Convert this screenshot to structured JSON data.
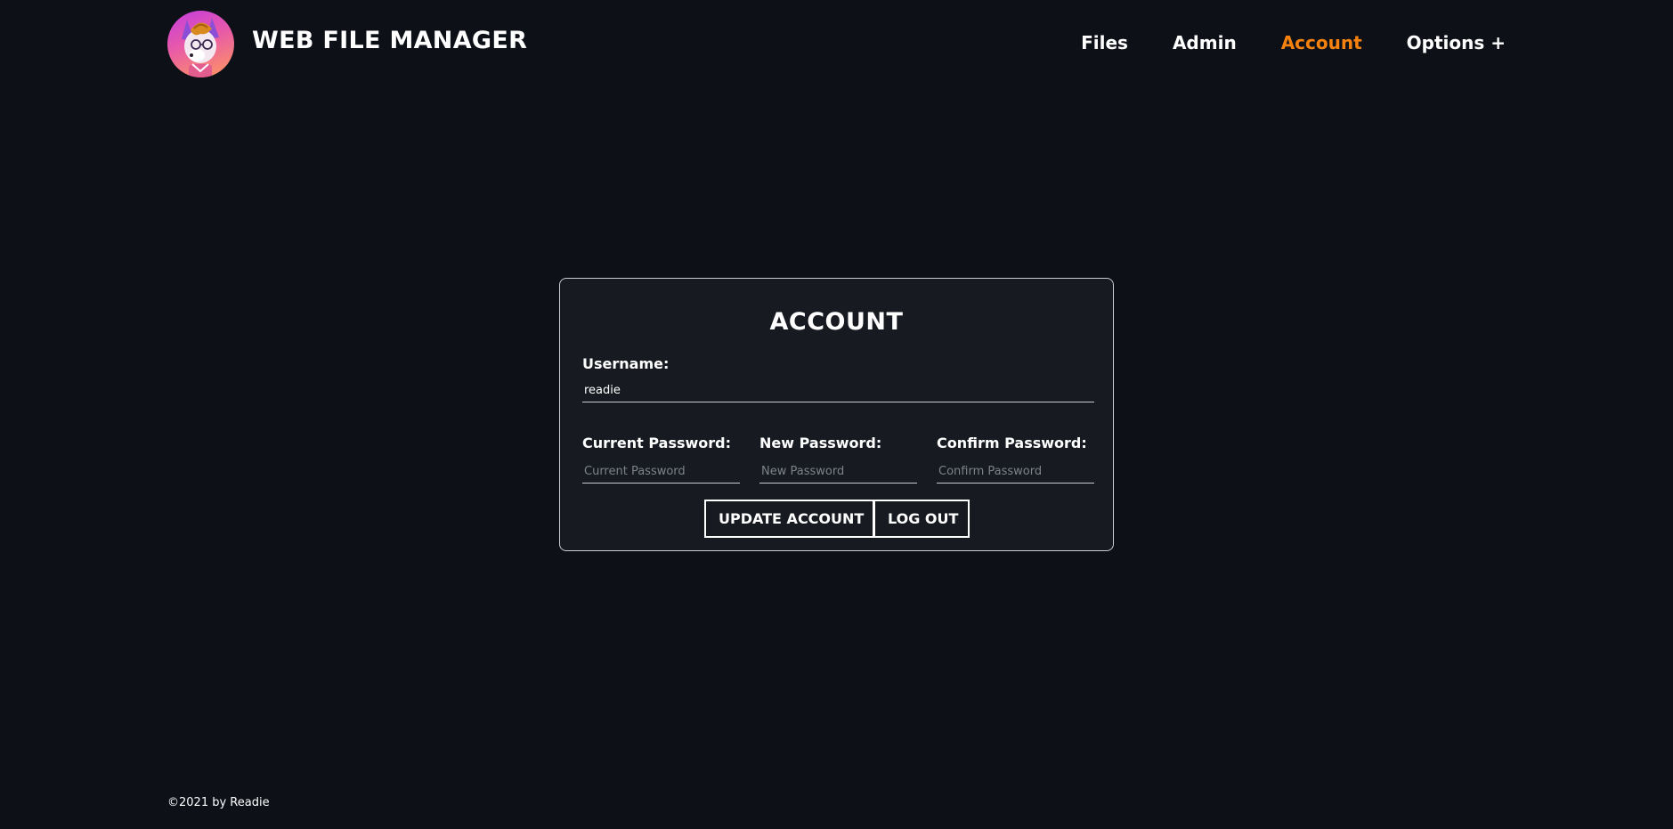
{
  "header": {
    "site_title": "WEB FILE MANAGER",
    "avatar_icon": "fox-avatar-icon"
  },
  "nav": {
    "items": [
      {
        "label": "Files",
        "active": false
      },
      {
        "label": "Admin",
        "active": false
      },
      {
        "label": "Account",
        "active": true
      },
      {
        "label": "Options +",
        "active": false
      }
    ]
  },
  "account": {
    "title": "ACCOUNT",
    "username_label": "Username:",
    "username_value": "readie",
    "current_password_label": "Current Password:",
    "current_password_placeholder": "Current Password",
    "new_password_label": "New Password:",
    "new_password_placeholder": "New Password",
    "confirm_password_label": "Confirm Password:",
    "confirm_password_placeholder": "Confirm Password",
    "update_button": "UPDATE ACCOUNT",
    "logout_button": "LOG OUT"
  },
  "footer": {
    "copyright": "©2021 by Readie"
  },
  "colors": {
    "background": "#0d1017",
    "card_background": "#171b21",
    "accent": "#f5820f",
    "text": "#ffffff"
  }
}
